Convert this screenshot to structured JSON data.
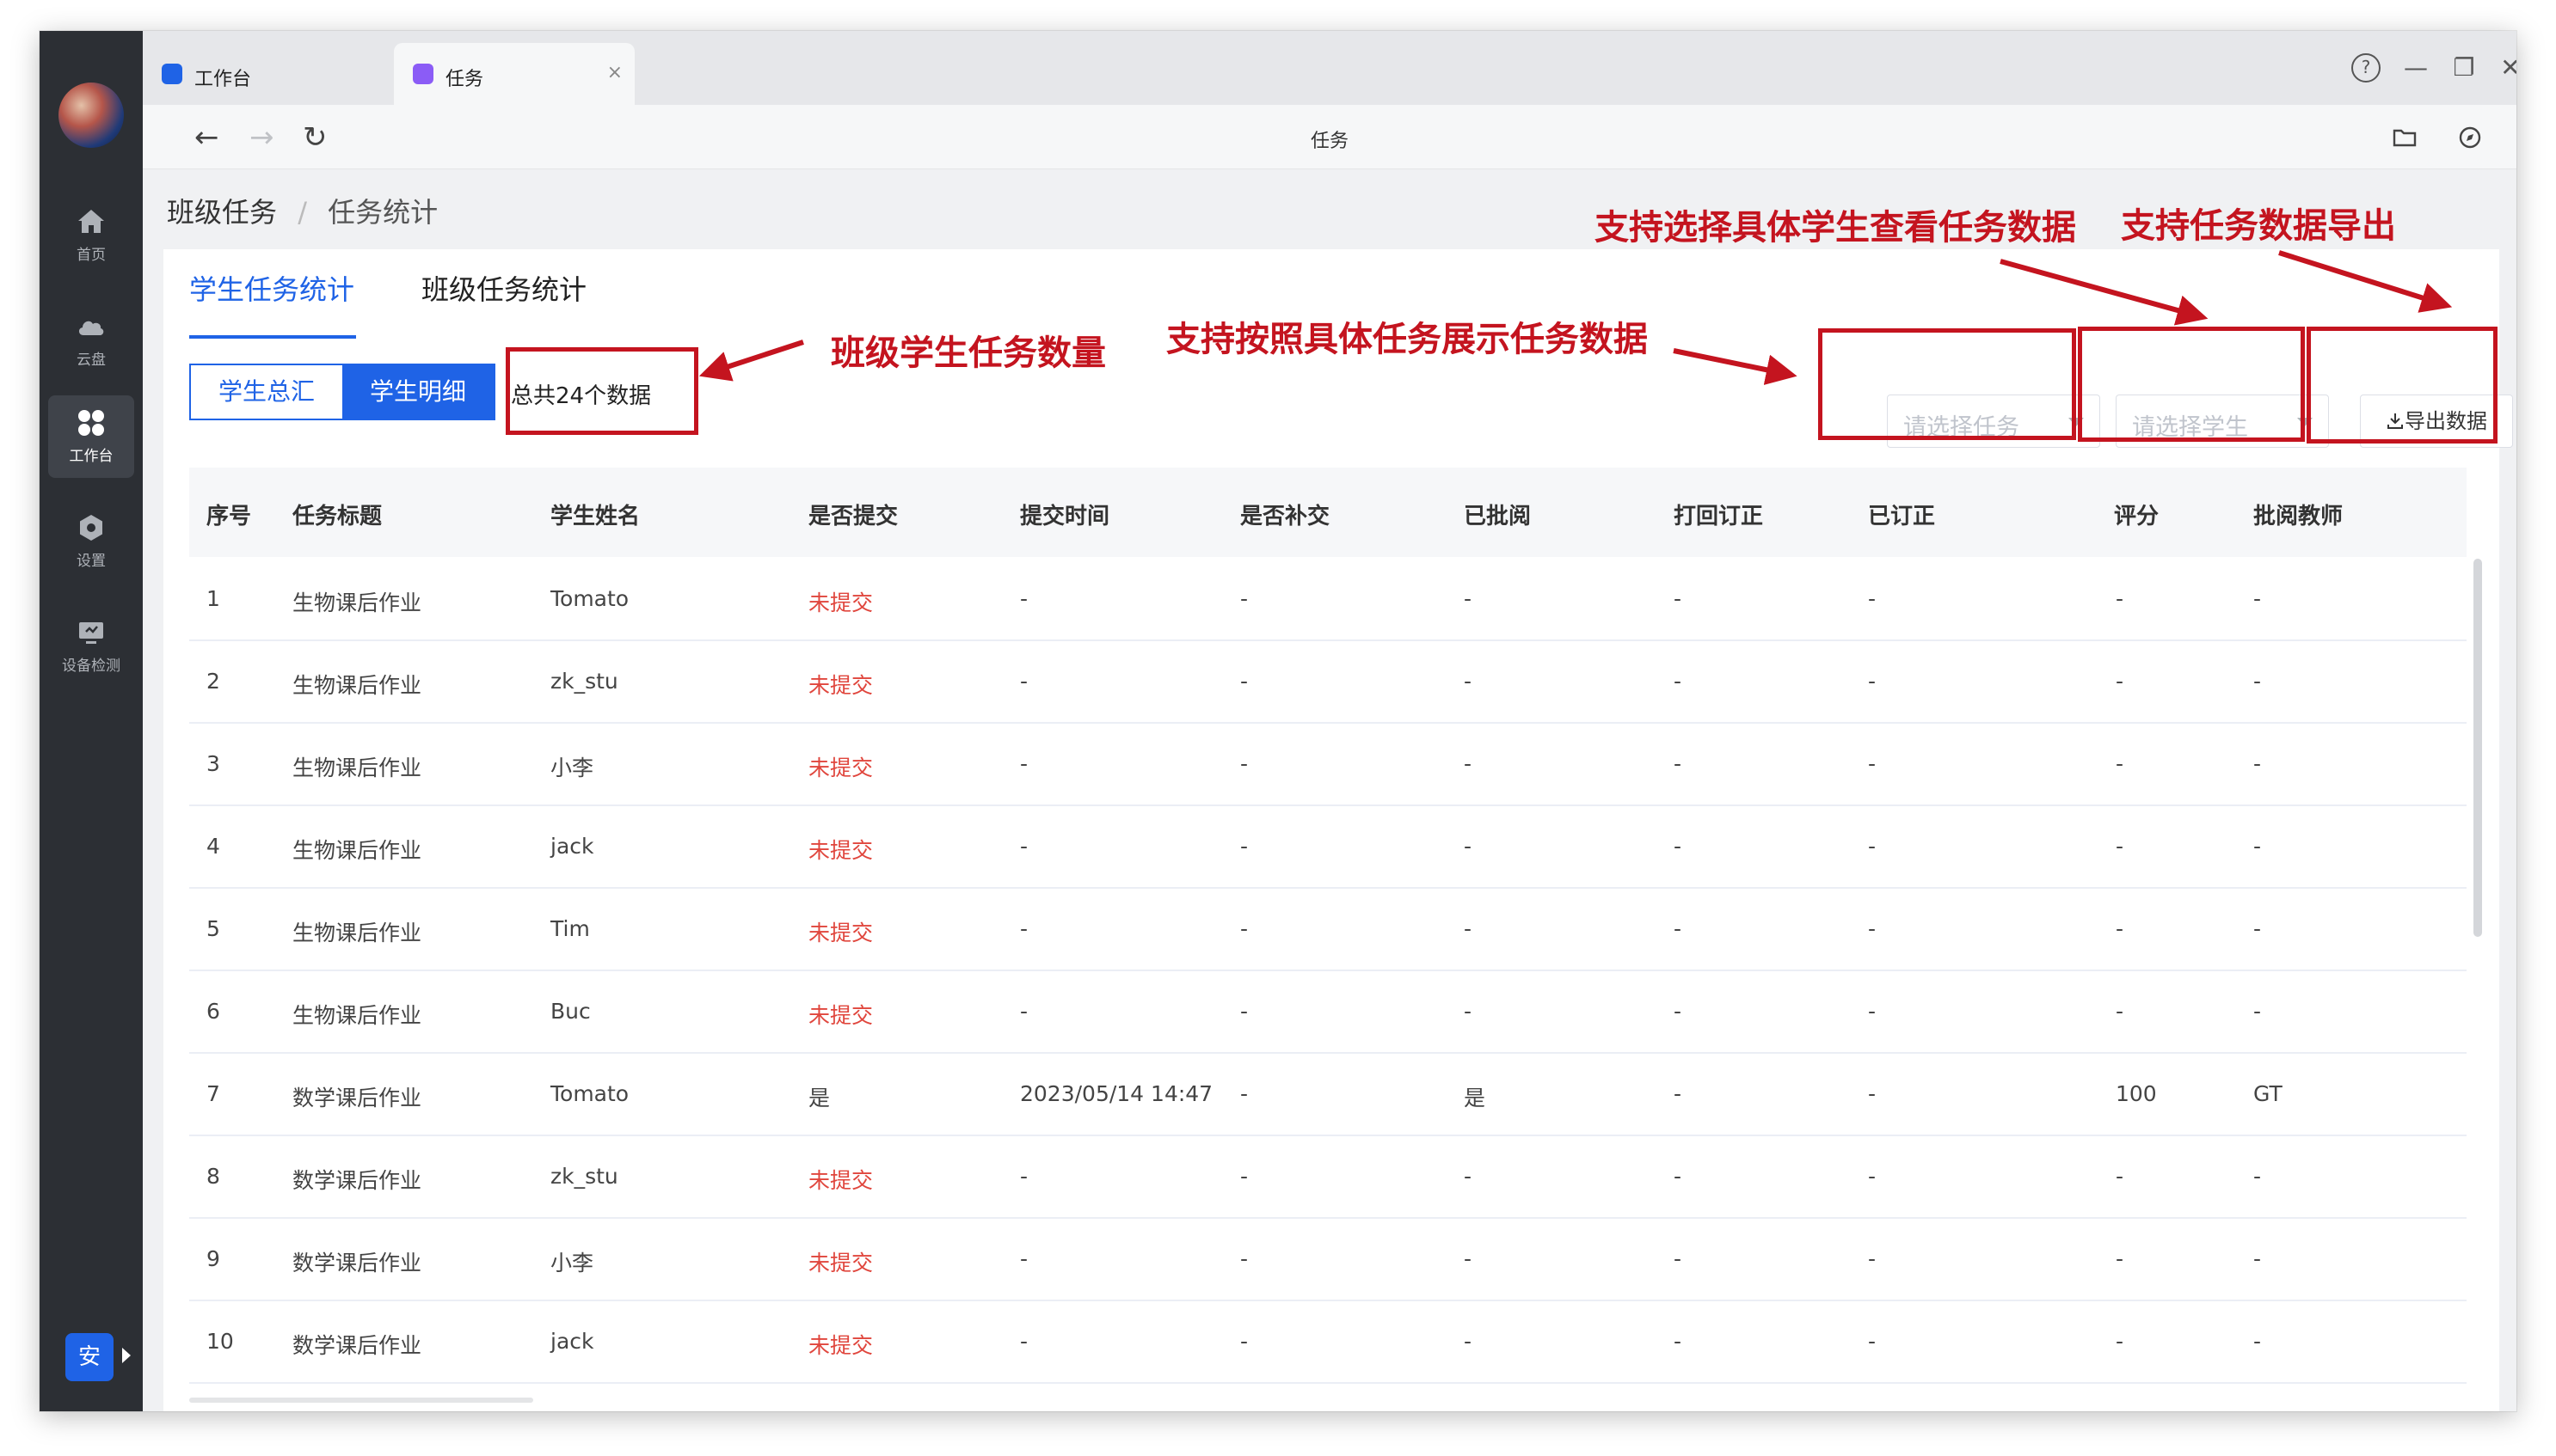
{
  "tabs": [
    {
      "label": "工作台"
    },
    {
      "label": "任务",
      "close": "×"
    }
  ],
  "window_controls": {
    "help": "?",
    "minimize": "—",
    "restore": "❐",
    "close": "✕"
  },
  "address": {
    "title": "任务",
    "back": "←",
    "forward": "→",
    "reload": "↻"
  },
  "sidebar": {
    "items": [
      {
        "label": "首页",
        "icon": "home-icon"
      },
      {
        "label": "云盘",
        "icon": "cloud-icon"
      },
      {
        "label": "工作台",
        "icon": "grid-icon",
        "active": true
      },
      {
        "label": "设置",
        "icon": "gear-icon"
      },
      {
        "label": "设备检测",
        "icon": "monitor-icon"
      }
    ],
    "badge": "安"
  },
  "breadcrumb": {
    "parent": "班级任务",
    "separator": "/",
    "current": "任务统计"
  },
  "panel": {
    "tabs": [
      {
        "label": "学生任务统计",
        "active": true
      },
      {
        "label": "班级任务统计"
      }
    ],
    "segments": [
      {
        "label": "学生总汇"
      },
      {
        "label": "学生明细",
        "active": true
      }
    ],
    "count_text": "总共24个数据",
    "task_select_placeholder": "请选择任务",
    "student_select_placeholder": "请选择学生",
    "export_label": "导出数据"
  },
  "table": {
    "headers": [
      "序号",
      "任务标题",
      "学生姓名",
      "是否提交",
      "提交时间",
      "是否补交",
      "已批阅",
      "打回订正",
      "已订正",
      "评分",
      "批阅教师"
    ],
    "rows": [
      [
        "1",
        "生物课后作业",
        "Tomato",
        "未提交",
        "-",
        "-",
        "-",
        "-",
        "-",
        "-",
        "-"
      ],
      [
        "2",
        "生物课后作业",
        "zk_stu",
        "未提交",
        "-",
        "-",
        "-",
        "-",
        "-",
        "-",
        "-"
      ],
      [
        "3",
        "生物课后作业",
        "小李",
        "未提交",
        "-",
        "-",
        "-",
        "-",
        "-",
        "-",
        "-"
      ],
      [
        "4",
        "生物课后作业",
        "jack",
        "未提交",
        "-",
        "-",
        "-",
        "-",
        "-",
        "-",
        "-"
      ],
      [
        "5",
        "生物课后作业",
        "Tim",
        "未提交",
        "-",
        "-",
        "-",
        "-",
        "-",
        "-",
        "-"
      ],
      [
        "6",
        "生物课后作业",
        "Buc",
        "未提交",
        "-",
        "-",
        "-",
        "-",
        "-",
        "-",
        "-"
      ],
      [
        "7",
        "数学课后作业",
        "Tomato",
        "是",
        "2023/05/14 14:47",
        "-",
        "是",
        "-",
        "-",
        "100",
        "GT"
      ],
      [
        "8",
        "数学课后作业",
        "zk_stu",
        "未提交",
        "-",
        "-",
        "-",
        "-",
        "-",
        "-",
        "-"
      ],
      [
        "9",
        "数学课后作业",
        "小李",
        "未提交",
        "-",
        "-",
        "-",
        "-",
        "-",
        "-",
        "-"
      ],
      [
        "10",
        "数学课后作业",
        "jack",
        "未提交",
        "-",
        "-",
        "-",
        "-",
        "-",
        "-",
        "-"
      ]
    ]
  },
  "annotations": {
    "count": "班级学生任务数量",
    "by_task": "支持按照具体任务展示任务数据",
    "by_student": "支持选择具体学生查看任务数据",
    "export": "支持任务数据导出"
  },
  "colors": {
    "accent": "#1f63e6",
    "annotation": "#c4141f",
    "not_submitted": "#e0463d",
    "sidebar": "#2c2f34"
  }
}
